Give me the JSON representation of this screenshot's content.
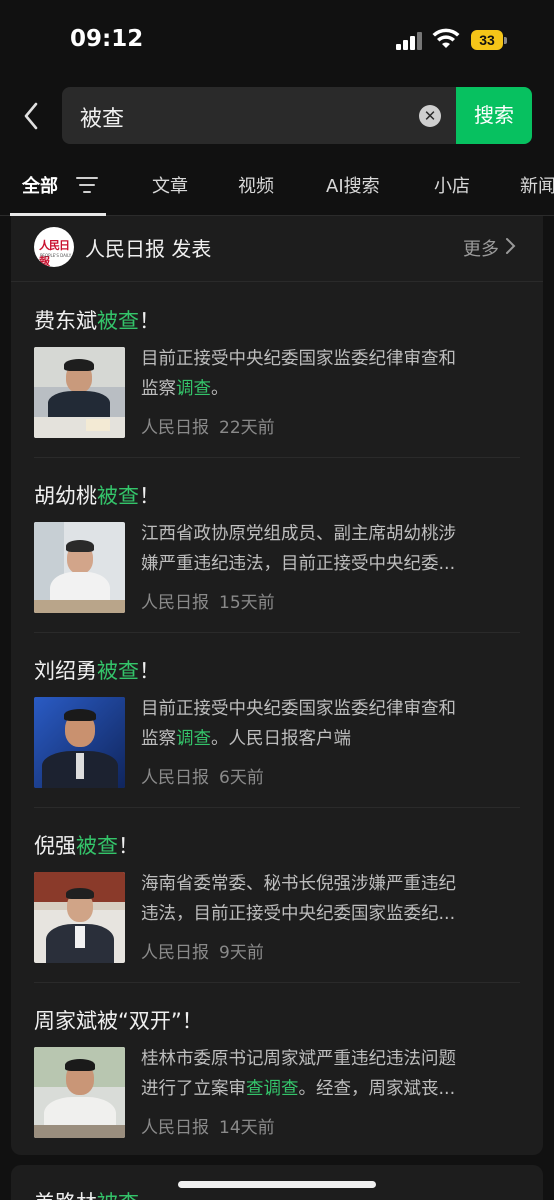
{
  "status_bar": {
    "time": "09:12",
    "battery": "33"
  },
  "search": {
    "query": "被查",
    "button": "搜索"
  },
  "tabs": [
    {
      "label": "全部"
    },
    {
      "label": "文章"
    },
    {
      "label": "视频"
    },
    {
      "label": "AI搜索"
    },
    {
      "label": "小店"
    },
    {
      "label": "新闻"
    }
  ],
  "source": {
    "name": "人民日报 发表",
    "more": "更多"
  },
  "results": [
    {
      "title_pre": "费东斌",
      "title_hl": "被查",
      "title_post": "！",
      "desc_line1": "目前正接受中央纪委国家监委纪律审查和",
      "desc_line2_pre": "监察",
      "desc_line2_hl": "调查",
      "desc_line2_post": "。",
      "source": "人民日报",
      "ago": "22天前"
    },
    {
      "title_pre": "胡幼桃",
      "title_hl": "被查",
      "title_post": "！",
      "desc_line1": "江西省政协原党组成员、副主席胡幼桃涉",
      "desc_line2_pre": "嫌严重违纪违法，目前正接受中央纪委...",
      "desc_line2_hl": "",
      "desc_line2_post": "",
      "source": "人民日报",
      "ago": "15天前"
    },
    {
      "title_pre": "刘绍勇",
      "title_hl": "被查",
      "title_post": "！",
      "desc_line1": "目前正接受中央纪委国家监委纪律审查和",
      "desc_line2_pre": "监察",
      "desc_line2_hl": "调查",
      "desc_line2_post": "。人民日报客户端",
      "source": "人民日报",
      "ago": "6天前"
    },
    {
      "title_pre": "倪强",
      "title_hl": "被查",
      "title_post": "！",
      "desc_line1": "海南省委常委、秘书长倪强涉嫌严重违纪",
      "desc_line2_pre": "违法，目前正接受中央纪委国家监委纪...",
      "desc_line2_hl": "",
      "desc_line2_post": "",
      "source": "人民日报",
      "ago": "9天前"
    },
    {
      "title_pre": "周家斌被“双开”！",
      "title_hl": "",
      "title_post": "",
      "desc_line1": "桂林市委原书记周家斌严重违纪违法问题",
      "desc_line2_pre": "进行了立案审",
      "desc_line2_hl": "查调查",
      "desc_line2_post": "。经查，周家斌丧...",
      "source": "人民日报",
      "ago": "14天前"
    }
  ],
  "next_result": {
    "title_pre": "羌路林",
    "title_hl": "被查"
  },
  "colors": {
    "accent": "#07c160",
    "highlight": "#34c46a",
    "background": "#111111",
    "card": "#1d1d1d",
    "battery": "#f5c518"
  }
}
